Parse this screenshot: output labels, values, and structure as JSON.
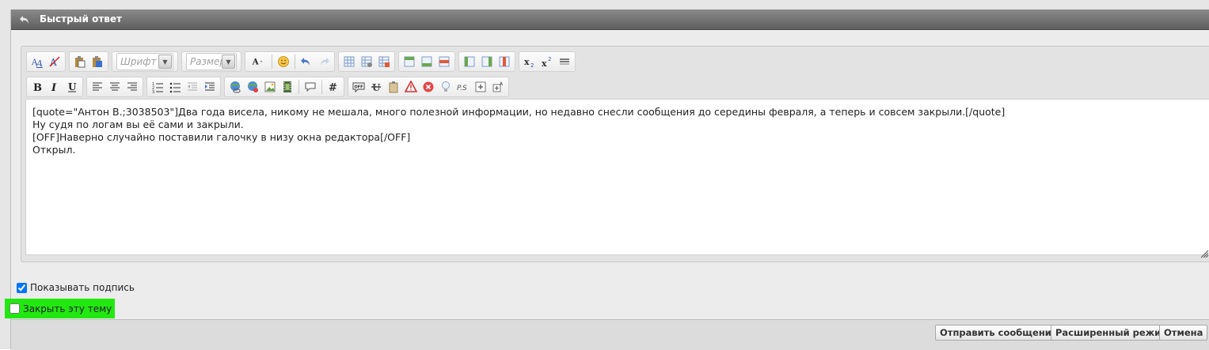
{
  "window": {
    "title": "Быстрый ответ"
  },
  "toolbar": {
    "font_placeholder": "Шрифт",
    "size_placeholder": "Размер"
  },
  "editor": {
    "content": "[quote=\"Антон В.;3038503\"]Два года висела, никому не мешала, много полезной информации, но недавно снесли сообщения до середины февраля, а теперь и совсем закрыли.[/quote]\nНу судя по логам вы её сами и закрыли.\n[OFF]Наверно случайно поставили галочку в низу окна редактора[/OFF]\nОткрыл."
  },
  "options": {
    "show_signature": {
      "label": "Показывать подпись",
      "checked": true
    },
    "close_thread": {
      "label": "Закрыть эту тему",
      "checked": false,
      "highlight": "#22e812"
    }
  },
  "buttons": {
    "submit": "Отправить сообщение",
    "advanced": "Расширенный режим",
    "cancel": "Отмена"
  }
}
